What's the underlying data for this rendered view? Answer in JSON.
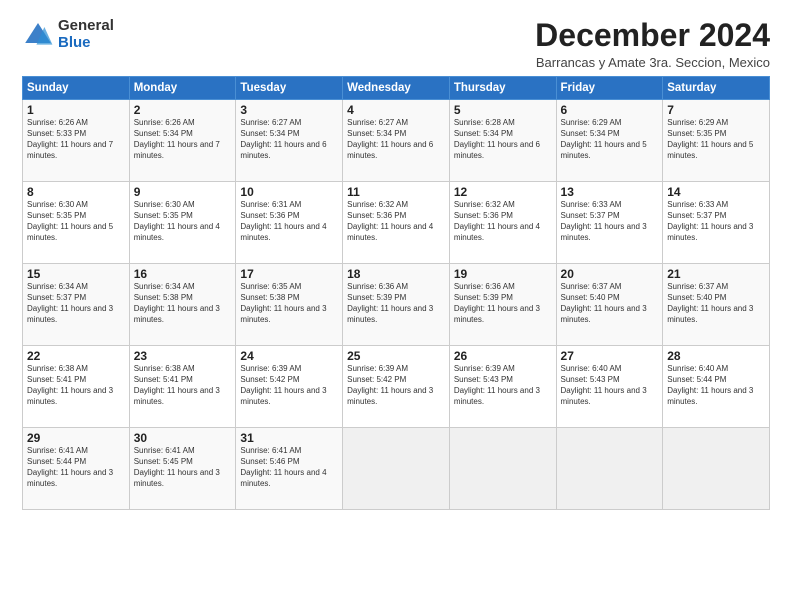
{
  "logo": {
    "general": "General",
    "blue": "Blue"
  },
  "title": "December 2024",
  "subtitle": "Barrancas y Amate 3ra. Seccion, Mexico",
  "days_header": [
    "Sunday",
    "Monday",
    "Tuesday",
    "Wednesday",
    "Thursday",
    "Friday",
    "Saturday"
  ],
  "weeks": [
    [
      {
        "day": "1",
        "sunrise": "6:26 AM",
        "sunset": "5:33 PM",
        "daylight": "11 hours and 7 minutes."
      },
      {
        "day": "2",
        "sunrise": "6:26 AM",
        "sunset": "5:34 PM",
        "daylight": "11 hours and 7 minutes."
      },
      {
        "day": "3",
        "sunrise": "6:27 AM",
        "sunset": "5:34 PM",
        "daylight": "11 hours and 6 minutes."
      },
      {
        "day": "4",
        "sunrise": "6:27 AM",
        "sunset": "5:34 PM",
        "daylight": "11 hours and 6 minutes."
      },
      {
        "day": "5",
        "sunrise": "6:28 AM",
        "sunset": "5:34 PM",
        "daylight": "11 hours and 6 minutes."
      },
      {
        "day": "6",
        "sunrise": "6:29 AM",
        "sunset": "5:34 PM",
        "daylight": "11 hours and 5 minutes."
      },
      {
        "day": "7",
        "sunrise": "6:29 AM",
        "sunset": "5:35 PM",
        "daylight": "11 hours and 5 minutes."
      }
    ],
    [
      {
        "day": "8",
        "sunrise": "6:30 AM",
        "sunset": "5:35 PM",
        "daylight": "11 hours and 5 minutes."
      },
      {
        "day": "9",
        "sunrise": "6:30 AM",
        "sunset": "5:35 PM",
        "daylight": "11 hours and 4 minutes."
      },
      {
        "day": "10",
        "sunrise": "6:31 AM",
        "sunset": "5:36 PM",
        "daylight": "11 hours and 4 minutes."
      },
      {
        "day": "11",
        "sunrise": "6:32 AM",
        "sunset": "5:36 PM",
        "daylight": "11 hours and 4 minutes."
      },
      {
        "day": "12",
        "sunrise": "6:32 AM",
        "sunset": "5:36 PM",
        "daylight": "11 hours and 4 minutes."
      },
      {
        "day": "13",
        "sunrise": "6:33 AM",
        "sunset": "5:37 PM",
        "daylight": "11 hours and 3 minutes."
      },
      {
        "day": "14",
        "sunrise": "6:33 AM",
        "sunset": "5:37 PM",
        "daylight": "11 hours and 3 minutes."
      }
    ],
    [
      {
        "day": "15",
        "sunrise": "6:34 AM",
        "sunset": "5:37 PM",
        "daylight": "11 hours and 3 minutes."
      },
      {
        "day": "16",
        "sunrise": "6:34 AM",
        "sunset": "5:38 PM",
        "daylight": "11 hours and 3 minutes."
      },
      {
        "day": "17",
        "sunrise": "6:35 AM",
        "sunset": "5:38 PM",
        "daylight": "11 hours and 3 minutes."
      },
      {
        "day": "18",
        "sunrise": "6:36 AM",
        "sunset": "5:39 PM",
        "daylight": "11 hours and 3 minutes."
      },
      {
        "day": "19",
        "sunrise": "6:36 AM",
        "sunset": "5:39 PM",
        "daylight": "11 hours and 3 minutes."
      },
      {
        "day": "20",
        "sunrise": "6:37 AM",
        "sunset": "5:40 PM",
        "daylight": "11 hours and 3 minutes."
      },
      {
        "day": "21",
        "sunrise": "6:37 AM",
        "sunset": "5:40 PM",
        "daylight": "11 hours and 3 minutes."
      }
    ],
    [
      {
        "day": "22",
        "sunrise": "6:38 AM",
        "sunset": "5:41 PM",
        "daylight": "11 hours and 3 minutes."
      },
      {
        "day": "23",
        "sunrise": "6:38 AM",
        "sunset": "5:41 PM",
        "daylight": "11 hours and 3 minutes."
      },
      {
        "day": "24",
        "sunrise": "6:39 AM",
        "sunset": "5:42 PM",
        "daylight": "11 hours and 3 minutes."
      },
      {
        "day": "25",
        "sunrise": "6:39 AM",
        "sunset": "5:42 PM",
        "daylight": "11 hours and 3 minutes."
      },
      {
        "day": "26",
        "sunrise": "6:39 AM",
        "sunset": "5:43 PM",
        "daylight": "11 hours and 3 minutes."
      },
      {
        "day": "27",
        "sunrise": "6:40 AM",
        "sunset": "5:43 PM",
        "daylight": "11 hours and 3 minutes."
      },
      {
        "day": "28",
        "sunrise": "6:40 AM",
        "sunset": "5:44 PM",
        "daylight": "11 hours and 3 minutes."
      }
    ],
    [
      {
        "day": "29",
        "sunrise": "6:41 AM",
        "sunset": "5:44 PM",
        "daylight": "11 hours and 3 minutes."
      },
      {
        "day": "30",
        "sunrise": "6:41 AM",
        "sunset": "5:45 PM",
        "daylight": "11 hours and 3 minutes."
      },
      {
        "day": "31",
        "sunrise": "6:41 AM",
        "sunset": "5:46 PM",
        "daylight": "11 hours and 4 minutes."
      },
      null,
      null,
      null,
      null
    ]
  ]
}
